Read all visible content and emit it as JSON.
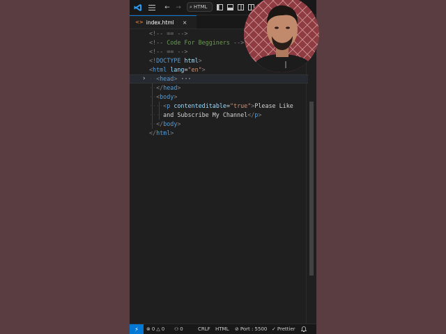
{
  "titlebar": {
    "search_label": "HTML",
    "icons": [
      "vscode-logo-icon",
      "menu-icon",
      "back-icon",
      "forward-icon",
      "search-icon",
      "layout-icon"
    ]
  },
  "tab": {
    "filename": "index.html",
    "icon_text": "<>",
    "close": "×"
  },
  "editor": {
    "lines": [
      {
        "parts": [
          {
            "c": "d",
            "t": "<!-- == -->"
          }
        ]
      },
      {
        "parts": [
          {
            "c": "d",
            "t": "<!-- "
          },
          {
            "c": "c",
            "t": "Code For Begginers"
          },
          {
            "c": "d",
            "t": " -->"
          }
        ]
      },
      {
        "parts": [
          {
            "c": "d",
            "t": "<!-- == -->"
          }
        ]
      },
      {
        "parts": [
          {
            "c": "d",
            "t": "<!"
          },
          {
            "c": "t",
            "t": "DOCTYPE"
          },
          {
            "c": "w",
            "t": " "
          },
          {
            "c": "a",
            "t": "html"
          },
          {
            "c": "d",
            "t": ">"
          }
        ]
      },
      {
        "parts": [
          {
            "c": "d",
            "t": "<"
          },
          {
            "c": "t",
            "t": "html"
          },
          {
            "c": "w",
            "t": " "
          },
          {
            "c": "a",
            "t": "lang"
          },
          {
            "c": "w",
            "t": "="
          },
          {
            "c": "s",
            "t": "\"en\""
          },
          {
            "c": "d",
            "t": ">"
          }
        ]
      },
      {
        "parts": [
          {
            "c": "ws",
            "t": "··"
          },
          {
            "c": "d",
            "t": "<"
          },
          {
            "c": "t",
            "t": "head"
          },
          {
            "c": "d",
            "t": ">"
          },
          {
            "c": "w",
            "t": " ···"
          }
        ]
      },
      {
        "parts": [
          {
            "c": "ws",
            "t": "··"
          },
          {
            "c": "d",
            "t": "</"
          },
          {
            "c": "t",
            "t": "head"
          },
          {
            "c": "d",
            "t": ">"
          }
        ]
      },
      {
        "parts": [
          {
            "c": "ws",
            "t": "··"
          },
          {
            "c": "d",
            "t": "<"
          },
          {
            "c": "t",
            "t": "body"
          },
          {
            "c": "d",
            "t": ">"
          }
        ]
      },
      {
        "parts": [
          {
            "c": "ws",
            "t": "····"
          },
          {
            "c": "d",
            "t": "<"
          },
          {
            "c": "t",
            "t": "p"
          },
          {
            "c": "w",
            "t": " "
          },
          {
            "c": "a",
            "t": "contenteditable"
          },
          {
            "c": "w",
            "t": "="
          },
          {
            "c": "s",
            "t": "\"true\""
          },
          {
            "c": "d",
            "t": ">"
          },
          {
            "c": "w",
            "t": "Please Like"
          }
        ]
      },
      {
        "parts": [
          {
            "c": "ws",
            "t": "····"
          },
          {
            "c": "w",
            "t": "and Subscribe My Channel"
          },
          {
            "c": "d",
            "t": "</"
          },
          {
            "c": "t",
            "t": "p"
          },
          {
            "c": "d",
            "t": ">"
          }
        ]
      },
      {
        "parts": [
          {
            "c": "ws",
            "t": "··"
          },
          {
            "c": "d",
            "t": "</"
          },
          {
            "c": "t",
            "t": "body"
          },
          {
            "c": "d",
            "t": ">"
          }
        ]
      },
      {
        "parts": [
          {
            "c": "d",
            "t": "</"
          },
          {
            "c": "t",
            "t": "html"
          },
          {
            "c": "d",
            "t": ">"
          }
        ]
      }
    ]
  },
  "statusbar": {
    "remote": "⚡",
    "errors": "0",
    "warnings": "0",
    "ports": "0",
    "eol": "CRLF",
    "language": "HTML",
    "live_server": "Port : 5500",
    "prettier": "Prettier",
    "bell": "🔔"
  },
  "colors": {
    "background": "#5a3d40",
    "editor": "#1f1f1f",
    "accent": "#0078d4"
  }
}
